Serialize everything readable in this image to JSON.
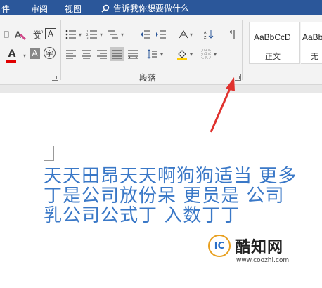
{
  "menubar": {
    "items": [
      "件",
      "审阅",
      "视图"
    ],
    "search_text": "告诉我你想要做什么"
  },
  "ribbon": {
    "font_buttons": {
      "clear_format": "A",
      "char_border": "A",
      "font_color": "A",
      "char_shading": "A",
      "enclose_char": "字"
    },
    "paragraph_group_label": "段落",
    "styles": [
      {
        "preview": "AaBbCcD",
        "name": "正文"
      },
      {
        "preview": "AaBbC",
        "name": "无"
      }
    ]
  },
  "document": {
    "lines": [
      "天天田昂天天啊狗狗适当 更多",
      "丁是公司放份呆 更员是 公司",
      "乳公司公式丁 入数丁丁"
    ]
  },
  "watermark": {
    "logo_text": "IC",
    "brand": "酷知网",
    "url": "www.coozhi.com"
  },
  "colors": {
    "menubar_bg": "#2b579a",
    "ribbon_bg": "#f3f3f3",
    "doc_text": "#3a78c7",
    "arrow": "#e0322e"
  }
}
